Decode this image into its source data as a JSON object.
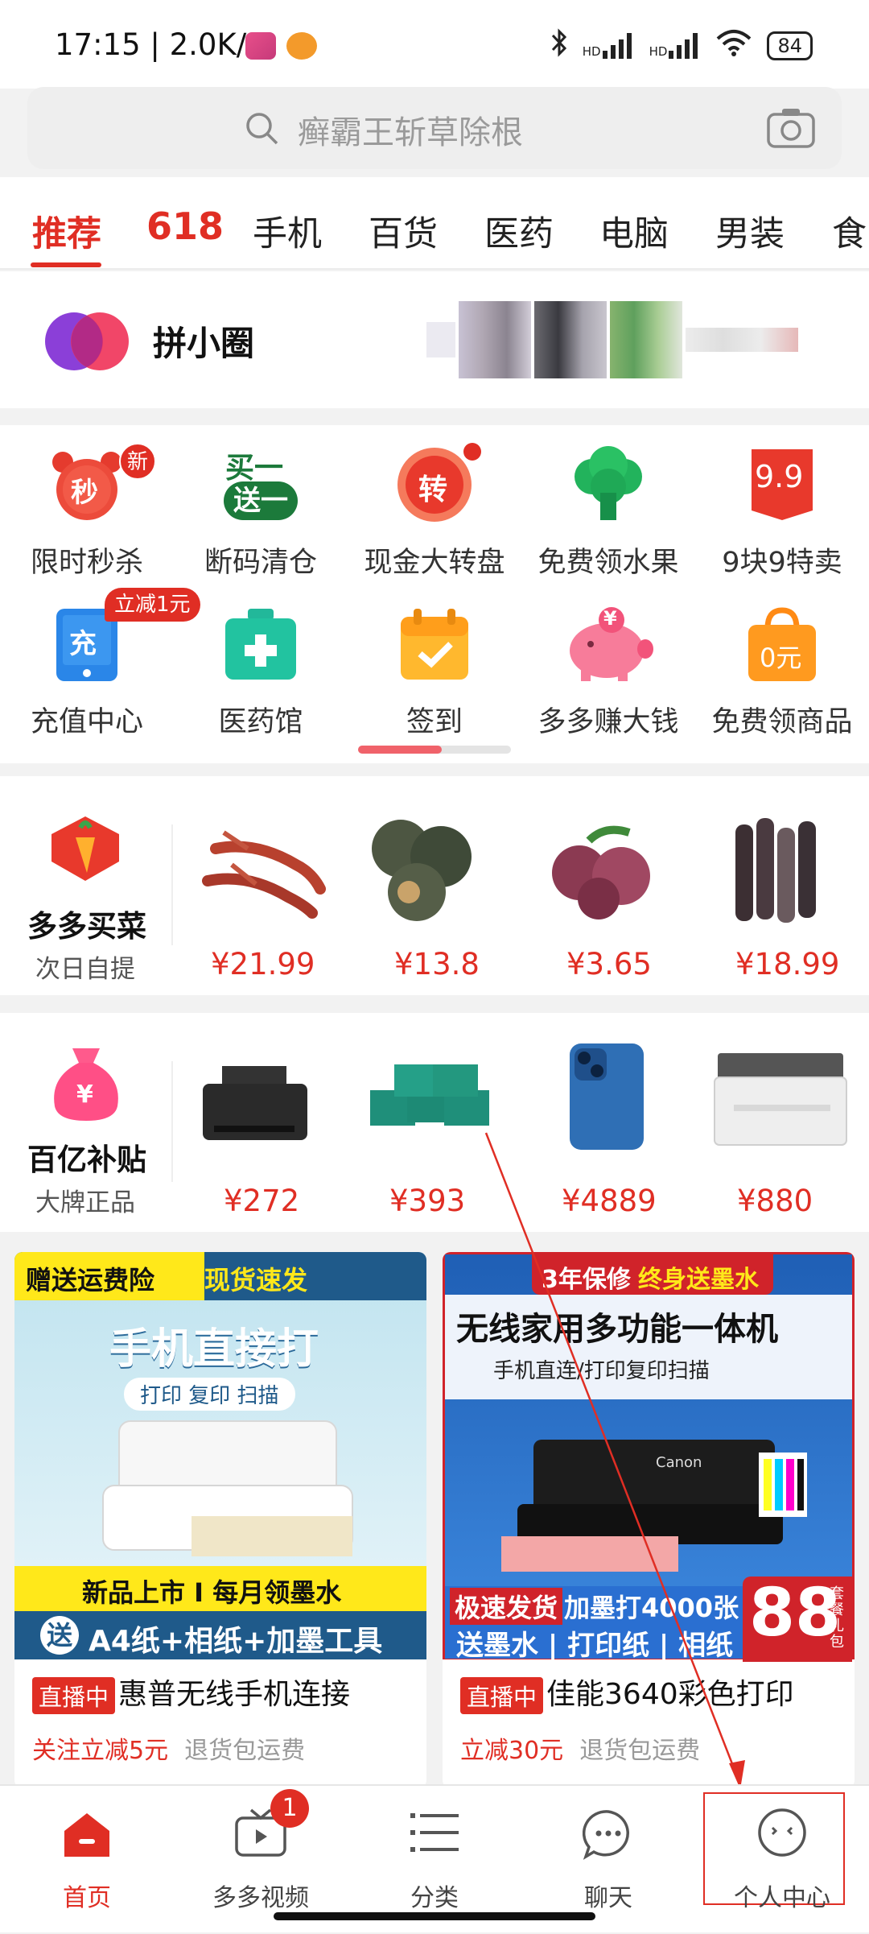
{
  "status": {
    "time": "17:15 | 2.0K/s",
    "battery": "84",
    "hd1": "HD",
    "hd2": "HD"
  },
  "search": {
    "placeholder": "癣霸王斩草除根"
  },
  "tabs": [
    "推荐",
    "618",
    "手机",
    "百货",
    "医药",
    "电脑",
    "男装",
    "食"
  ],
  "circle": {
    "label": "拼小圈"
  },
  "grid": {
    "row1": [
      {
        "label": "限时秒杀",
        "icon": "alarm-clock-icon",
        "badge": "新",
        "glyph": "秒"
      },
      {
        "label": "断码清仓",
        "icon": "buy-one-get-one-icon",
        "glyph_top": "买一",
        "glyph_bottom": "送一"
      },
      {
        "label": "现金大转盘",
        "icon": "spin-wheel-icon",
        "glyph": "转"
      },
      {
        "label": "免费领水果",
        "icon": "tree-icon"
      },
      {
        "label": "9块9特卖",
        "icon": "price-tag-icon",
        "glyph": "9.9"
      }
    ],
    "row2": [
      {
        "label": "充值中心",
        "icon": "phone-recharge-icon",
        "badge": "立减1元",
        "glyph": "充"
      },
      {
        "label": "医药馆",
        "icon": "medicine-box-icon"
      },
      {
        "label": "签到",
        "icon": "calendar-check-icon"
      },
      {
        "label": "多多赚大钱",
        "icon": "piggy-bank-icon",
        "glyph": "¥"
      },
      {
        "label": "免费领商品",
        "icon": "shopping-bag-icon",
        "glyph": "0元"
      }
    ]
  },
  "veg": {
    "title": "多多买菜",
    "sub": "次日自提",
    "prices": [
      "¥21.99",
      "¥13.8",
      "¥3.65",
      "¥18.99"
    ]
  },
  "subsidy": {
    "title": "百亿补贴",
    "sub": "大牌正品",
    "glyph": "¥",
    "prices": [
      "¥272",
      "¥393",
      "¥4889",
      "¥880"
    ]
  },
  "cards": [
    {
      "banner_left": "赠送运费险",
      "banner_right": "现货速发",
      "headline": "手机直接打",
      "subline": "打印 复印 扫描",
      "bottom1": "新品上市 I 每月领墨水",
      "bottom2_prefix": "送",
      "bottom2": "A4纸+相纸+加墨工具",
      "live": "直播中",
      "title": "惠普无线手机连接",
      "promo": "关注立减5元",
      "return": "退货包运费"
    },
    {
      "banner_left": "3年保修",
      "banner_right": "终身送墨水",
      "headline": "无线家用多功能一体机",
      "subline": "手机直连/打印复印扫描",
      "bottom1": "极速发货",
      "bottom1b": "加墨打4000张",
      "bottom2": "送墨水 | 打印纸 | 相纸",
      "big": "88",
      "big_side": "套餐礼包",
      "brand": "Canon",
      "live": "直播中",
      "title": "佳能3640彩色打印",
      "promo": "立减30元",
      "return": "退货包运费"
    }
  ],
  "nav": [
    {
      "label": "首页",
      "icon": "home-icon",
      "active": true
    },
    {
      "label": "多多视频",
      "icon": "video-icon",
      "badge": "1"
    },
    {
      "label": "分类",
      "icon": "category-list-icon"
    },
    {
      "label": "聊天",
      "icon": "chat-bubble-icon"
    },
    {
      "label": "个人中心",
      "icon": "profile-icon"
    }
  ],
  "colors": {
    "brand": "#e02e24",
    "accent_green": "#1a9e4a"
  }
}
